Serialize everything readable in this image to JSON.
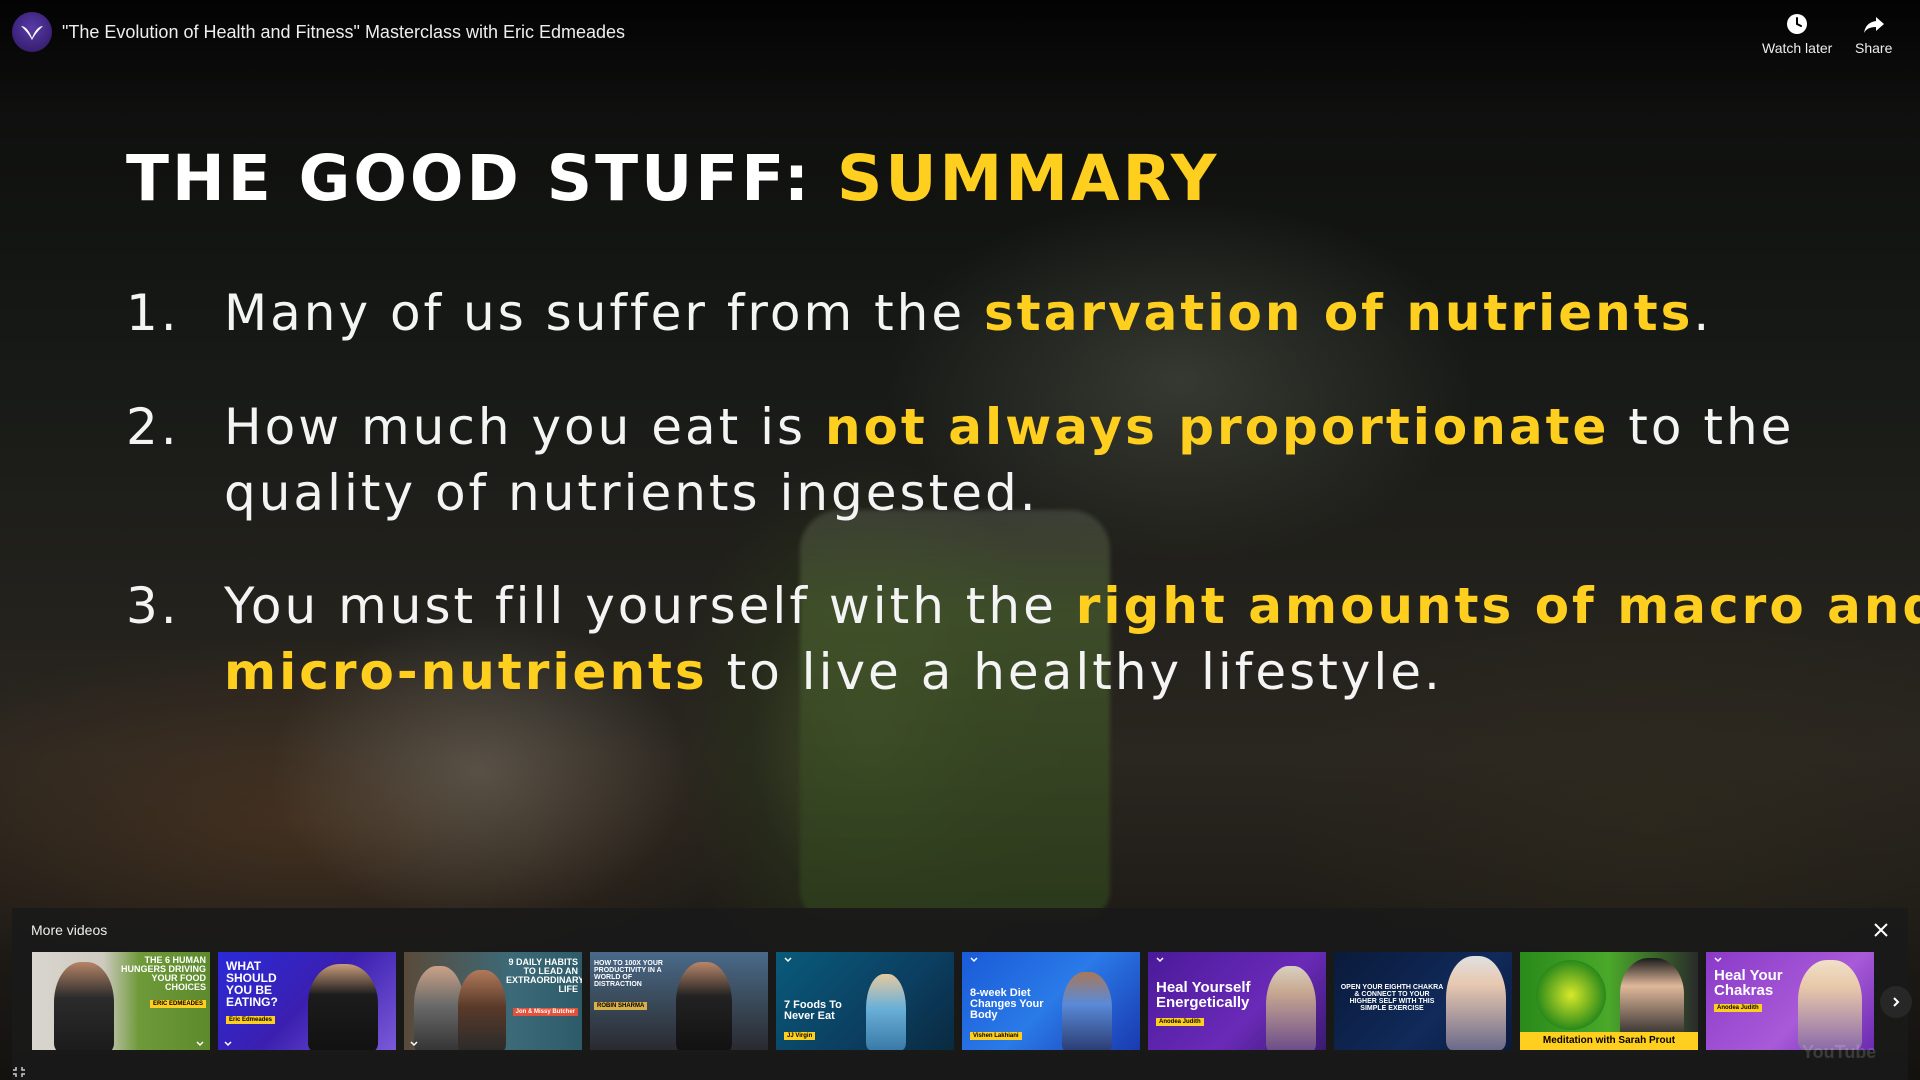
{
  "header": {
    "video_title": "\"The Evolution of Health and Fitness\" Masterclass with Eric Edmeades",
    "watch_later_label": "Watch later",
    "share_label": "Share"
  },
  "slide": {
    "heading_prefix": "THE GOOD STUFF: ",
    "heading_highlight": "SUMMARY",
    "points": [
      {
        "number": "1.",
        "line_parts": [
          "Many of us suffer from the ",
          "starvation of nutrients",
          "."
        ]
      },
      {
        "number": "2.",
        "line_parts": [
          "How much you eat is ",
          "not always proportionate",
          " to the quality of nutrients ingested."
        ]
      },
      {
        "number": "3.",
        "line_parts": [
          "You must fill yourself with the ",
          "right amounts of macro and micro-nutrients",
          " to live a healthy lifestyle."
        ]
      }
    ],
    "highlight_color": "#ffcf1f"
  },
  "more_videos": {
    "title": "More videos",
    "thumbnails": [
      {
        "text": "THE 6 HUMAN HUNGERS DRIVING YOUR FOOD CHOICES",
        "tag": "ERIC EDMEADES"
      },
      {
        "text": "WHAT SHOULD YOU BE EATING?",
        "tag": "Eric Edmeades"
      },
      {
        "text": "9 DAILY HABITS TO LEAD AN EXTRAORDINARY LIFE",
        "tag": "Jon & Missy Butcher"
      },
      {
        "text": "HOW TO 100X YOUR PRODUCTIVITY IN A WORLD OF DISTRACTION",
        "tag": "ROBIN SHARMA"
      },
      {
        "text": "7 Foods To Never Eat",
        "tag": "JJ Virgin"
      },
      {
        "text": "8-week Diet Changes Your Body",
        "tag": "Vishen Lakhiani"
      },
      {
        "text": "Heal Yourself Energetically",
        "tag": "Anodea Judith"
      },
      {
        "text": "OPEN YOUR EIGHTH CHAKRA & CONNECT TO YOUR HIGHER SELF WITH THIS SIMPLE EXERCISE",
        "tag": ""
      },
      {
        "text": "Meditation with Sarah Prout",
        "tag": ""
      },
      {
        "text": "Heal Your Chakras",
        "tag": "Anodea Judith"
      }
    ]
  },
  "watermark": "YouTube"
}
